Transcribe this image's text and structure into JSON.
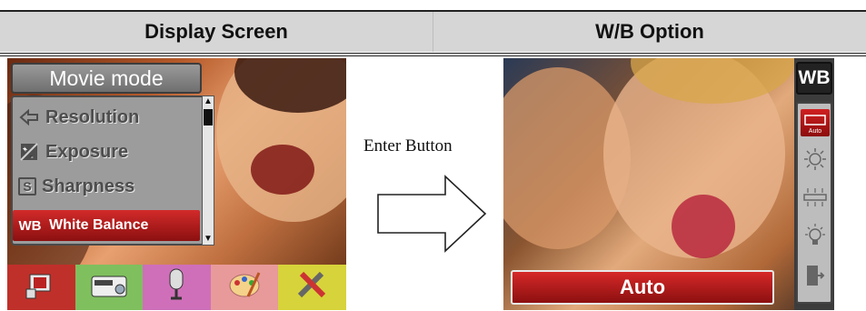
{
  "header": {
    "left_title": "Display Screen",
    "right_title": "W/B Option"
  },
  "left_screen": {
    "menu_title": "Movie mode",
    "menu_items": [
      {
        "label": "Resolution",
        "icon": "resolution-icon"
      },
      {
        "label": "Exposure",
        "icon": "exposure-icon"
      },
      {
        "label": "Sharpness",
        "icon": "sharpness-icon",
        "glyph": "S"
      },
      {
        "label": "White Balance",
        "icon": "white-balance-icon",
        "glyph": "WB",
        "selected": true
      }
    ],
    "tabs": [
      {
        "icon": "camcorder-icon",
        "color": "#c0302a"
      },
      {
        "icon": "camera-icon",
        "color": "#7fbf5e"
      },
      {
        "icon": "microphone-icon",
        "color": "#cf6fb9"
      },
      {
        "icon": "palette-icon",
        "color": "#e89a9a"
      },
      {
        "icon": "tools-icon",
        "color": "#d7d33a"
      }
    ]
  },
  "middle": {
    "enter_label": "Enter Button"
  },
  "right_screen": {
    "badge": "WB",
    "options": [
      {
        "icon": "auto-wb-icon",
        "label": "Auto",
        "selected": true
      },
      {
        "icon": "daylight-icon"
      },
      {
        "icon": "fluorescent-icon"
      },
      {
        "icon": "tungsten-icon"
      },
      {
        "icon": "exit-icon"
      }
    ],
    "status_value": "Auto"
  },
  "colors": {
    "header_bg": "#d6d6d6",
    "highlight_red": "#c41e1e",
    "menu_gray": "#9c9c9c"
  }
}
